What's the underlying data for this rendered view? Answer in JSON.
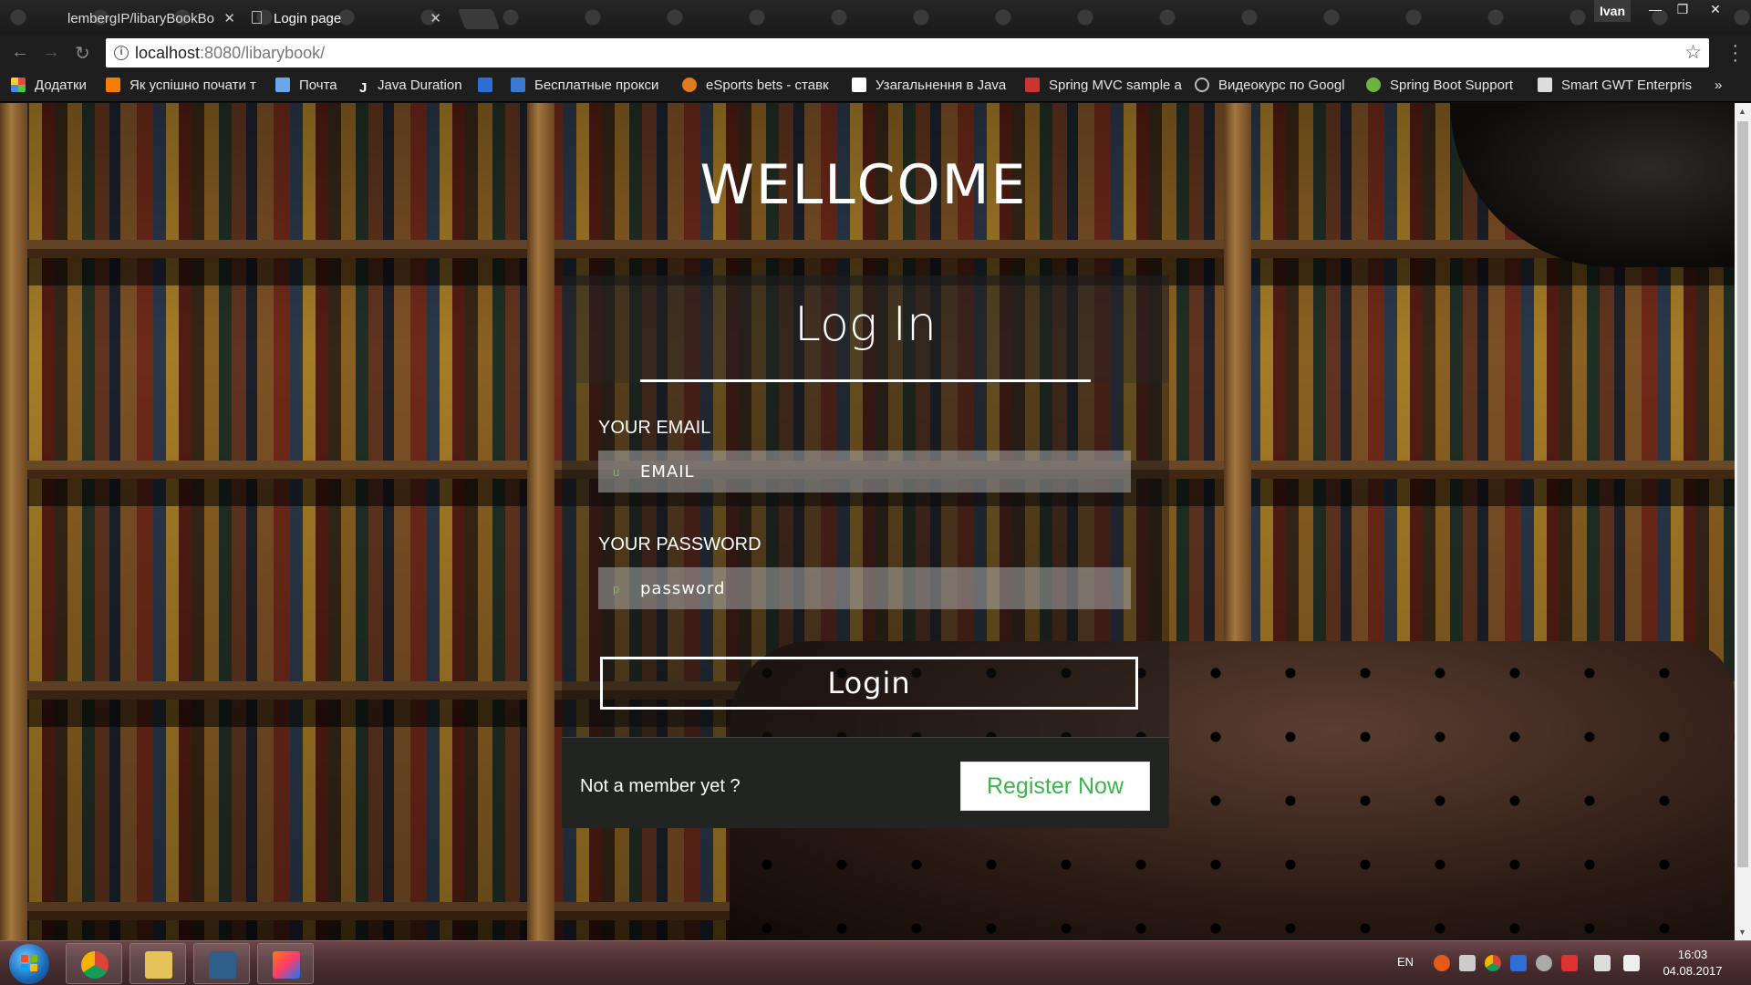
{
  "browser": {
    "tabs": [
      {
        "title": "lembergIP/libaryBookBo",
        "active": false
      },
      {
        "title": "Login page",
        "active": true
      }
    ],
    "user": "Ivan",
    "url_host": "localhost",
    "url_path": ":8080/libarybook/",
    "bookmarks": [
      "Додатки",
      "Як успішно почати т",
      "Почта",
      "Java Duration",
      "",
      "Бесплатные прокси",
      "eSports bets - ставк",
      "Узагальнення в Java",
      "Spring MVC sample a",
      "Видеокурс по Googl",
      "Spring Boot Support",
      "Smart GWT Enterpris"
    ],
    "more": "»"
  },
  "page": {
    "welcome": "WELLCOME",
    "title": "Log In",
    "email_label": "YOUR EMAIL",
    "email_placeholder": "EMAIL",
    "password_label": "YOUR PASSWORD",
    "password_placeholder": "password",
    "login_button": "Login",
    "not_member": "Not a member yet ?",
    "register_button": "Register Now",
    "accent_color": "#3cb54a"
  },
  "taskbar": {
    "language": "EN",
    "time": "16:03",
    "date": "04.08.2017"
  }
}
